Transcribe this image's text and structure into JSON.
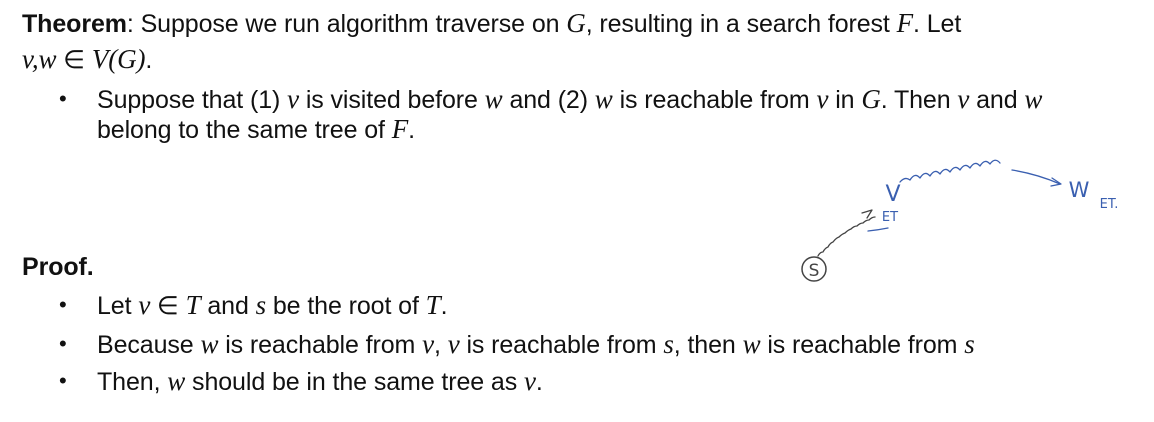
{
  "theorem": {
    "label": "Theorem",
    "line1": {
      "t1": ": Suppose we run algorithm traverse on ",
      "m1": "G",
      "t2": ", resulting in a search forest ",
      "m2": "F",
      "t3": ". Let"
    },
    "line2": {
      "m1": "v,w",
      "t1": " ∈ ",
      "m2": "V(G)",
      "t2": "."
    },
    "bullet": {
      "line1": {
        "t1": "Suppose that (1) ",
        "m1": "v",
        "t2": " is visited before ",
        "m2": "w",
        "t3": " and (2) ",
        "m3": "w",
        "t4": " is reachable from ",
        "m4": "v",
        "t5": " in ",
        "m5": "G",
        "t6": ". Then ",
        "m6": "v",
        "t7": " and ",
        "m7": "w"
      },
      "line2": {
        "t1": "belong to the same tree of ",
        "m1": "F",
        "t2": "."
      }
    }
  },
  "proof": {
    "label": "Proof",
    "label_suffix": ".",
    "bullets": [
      {
        "t1": "Let ",
        "m1": "v",
        "t2": " ∈ ",
        "m2": "T",
        "t3": " and ",
        "m3": "s",
        "t4": " be the root of ",
        "m4": "T",
        "t5": "."
      },
      {
        "t1": "Because ",
        "m1": "w",
        "t2": " is reachable from ",
        "m2": "v",
        "t3": ", ",
        "m3": "v",
        "t4": " is reachable from ",
        "m4": "s",
        "t5": ", then ",
        "m5": "w",
        "t6": " is reachable from ",
        "m6": "s"
      },
      {
        "t1": "Then, ",
        "m1": "w",
        "t2": " should be in the same tree as ",
        "m2": "v",
        "t3": "."
      }
    ]
  },
  "annotation": {
    "root_label": "S",
    "v_label": "V",
    "v_member": "ET",
    "w_label": "W",
    "w_member": "ET.",
    "colors": {
      "ink_blue": "#3a5fb0",
      "ink_dark": "#444444"
    }
  },
  "bullet_glyph": "•"
}
